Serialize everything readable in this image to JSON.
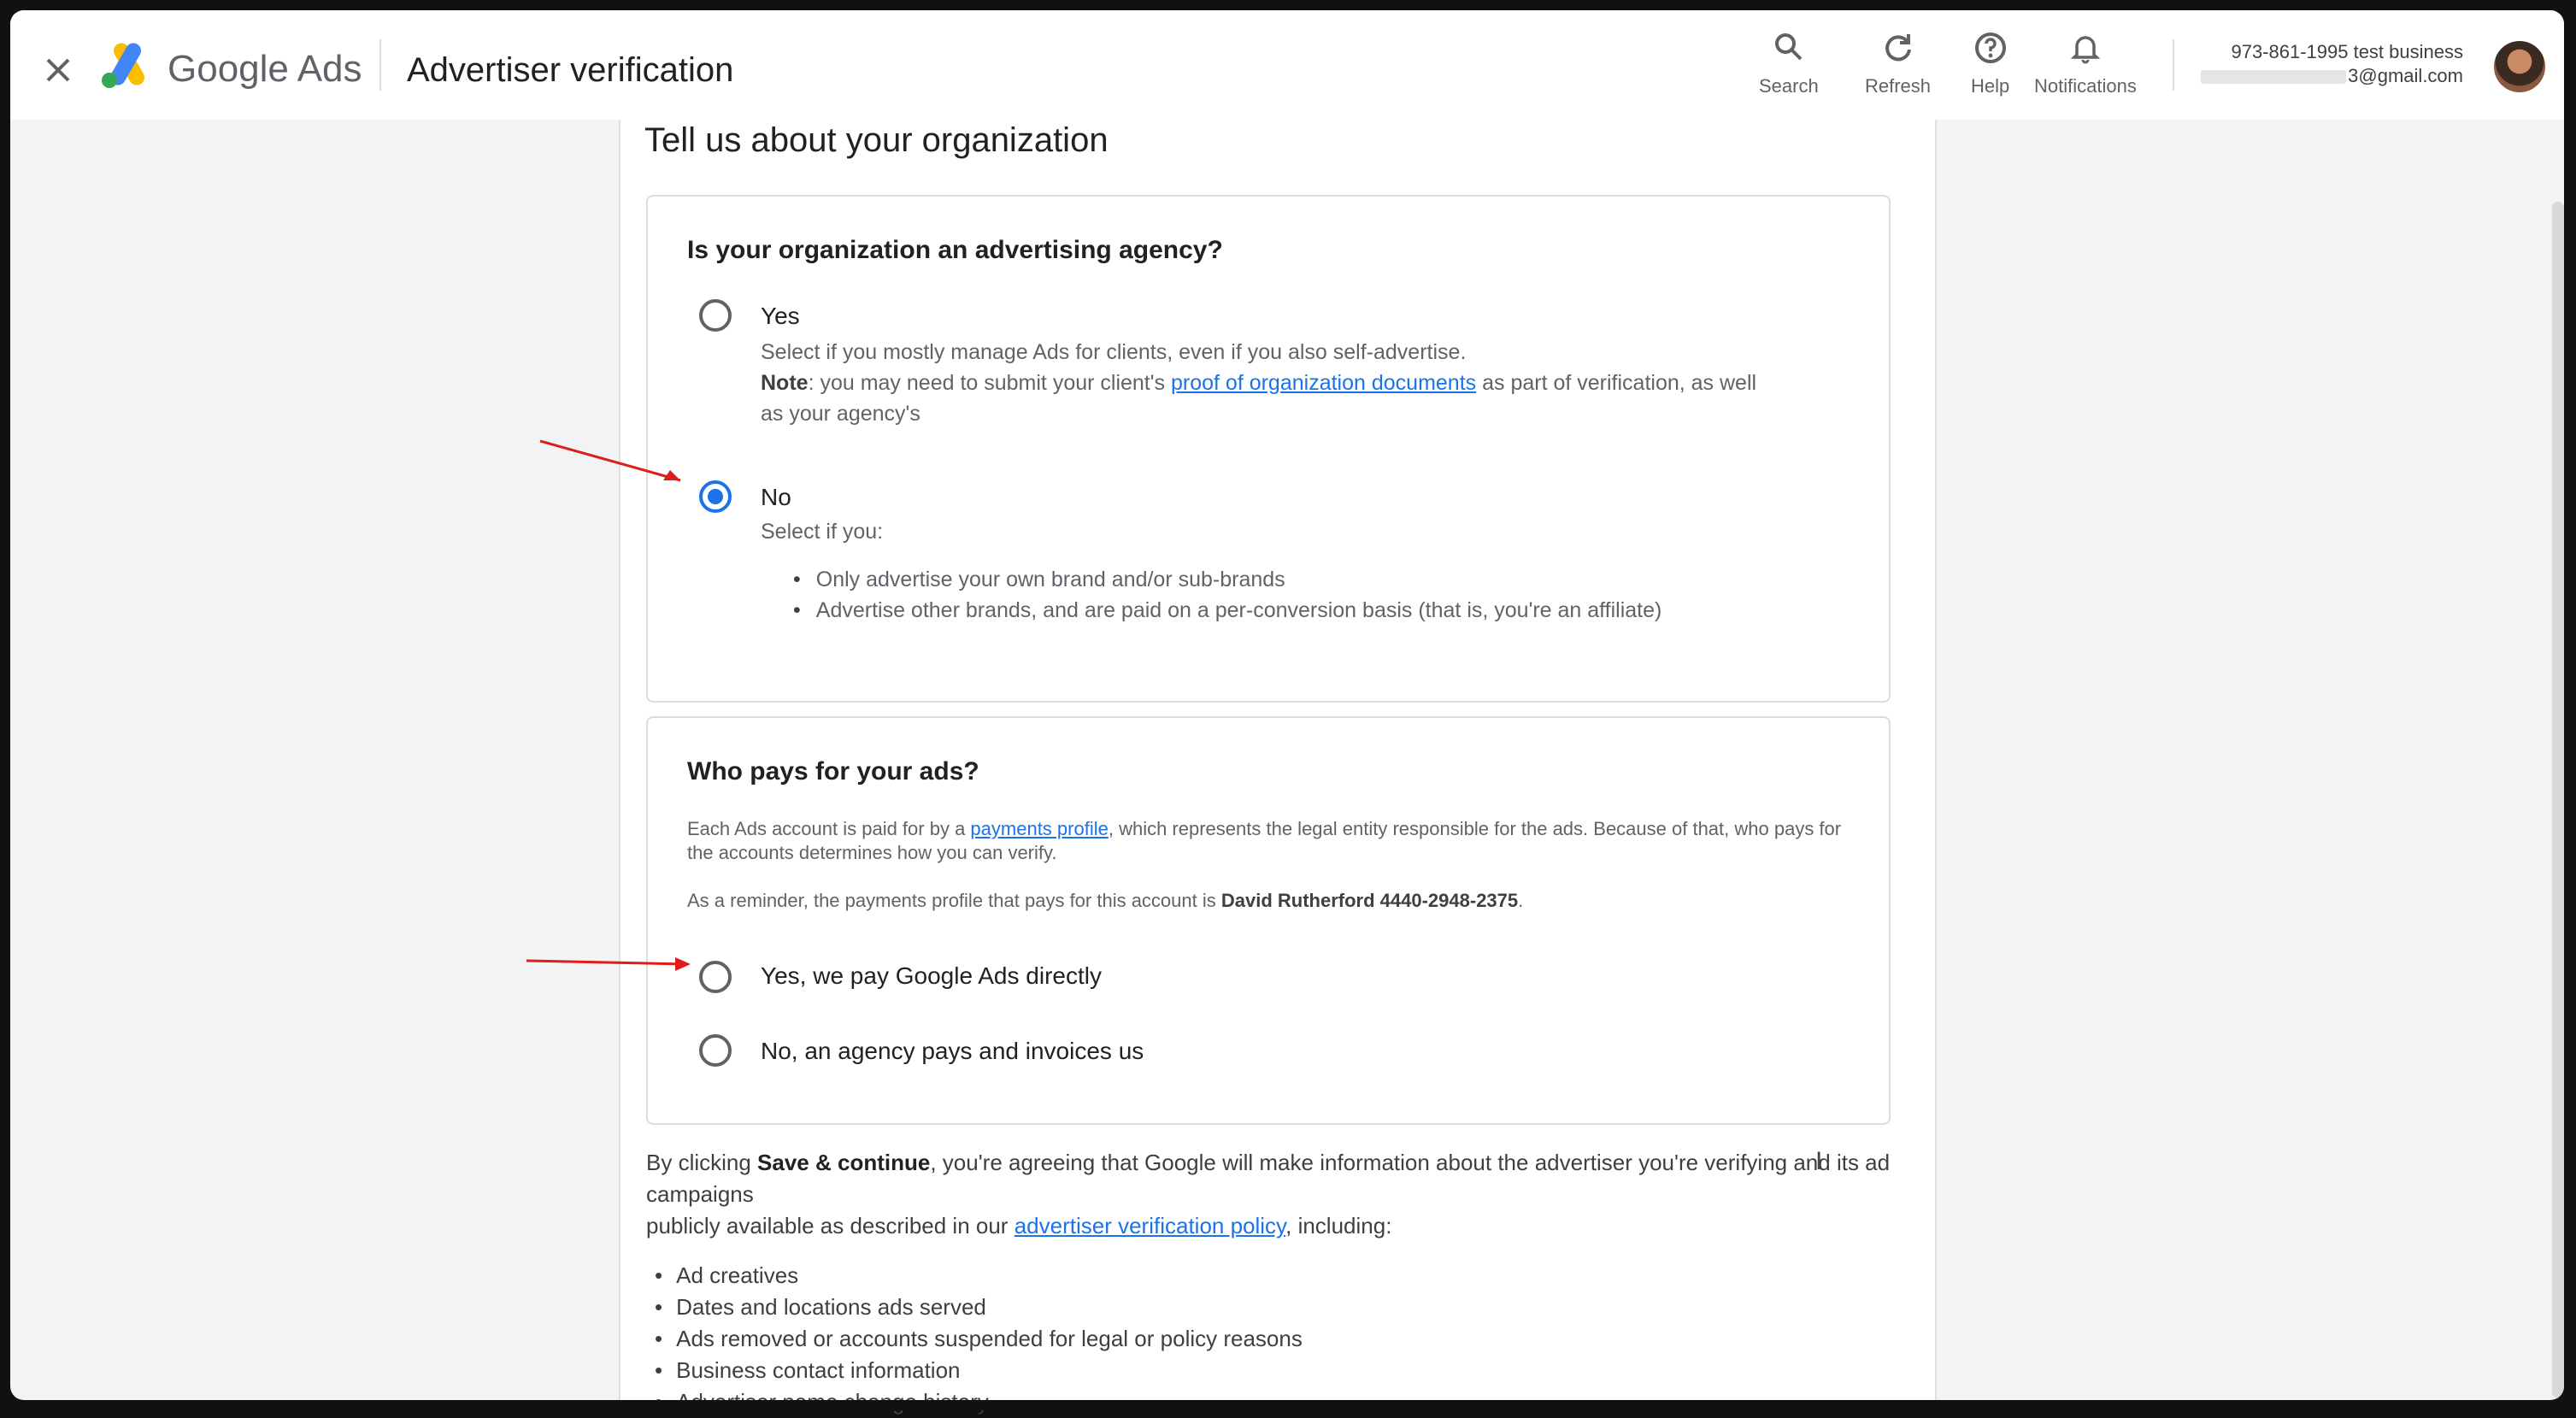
{
  "header": {
    "brand_google": "Google",
    "brand_ads": "Ads",
    "title": "Advertiser verification",
    "actions": {
      "search": "Search",
      "refresh": "Refresh",
      "help": "Help",
      "notifications": "Notifications"
    },
    "account_name": "973-861-1995 test business",
    "account_email_suffix": "3@gmail.com"
  },
  "section": {
    "title": "Tell us about your organization"
  },
  "agency_question": {
    "title": "Is your organization an advertising agency?",
    "yes_label": "Yes",
    "yes_desc_line1": "Select if you mostly manage Ads for clients, even if you also self-advertise.",
    "yes_note_bold": "Note",
    "yes_note_text": ": you may need to submit your client's ",
    "yes_note_link": "proof of organization documents",
    "yes_note_tail": " as part of verification, as well",
    "yes_note_line2": "as your agency's",
    "no_label": "No",
    "no_desc": "Select if you:",
    "no_bullets": [
      "Only advertise your own brand and/or sub-brands",
      "Advertise other brands, and are paid on a per-conversion basis (that is, you're an affiliate)"
    ],
    "selected": "No"
  },
  "pay_question": {
    "title": "Who pays for your ads?",
    "info1_pre": "Each Ads account is paid for by a ",
    "info1_link": "payments profile",
    "info1_post": ", which represents the legal entity responsible for the ads. Because of that, who pays for the accounts determines how you can verify.",
    "info2_pre": "As a reminder, the payments profile that pays for this account is ",
    "info2_bold": "David Rutherford 4440-2948-2375",
    "info2_post": ".",
    "option1": "Yes, we pay Google Ads directly",
    "option2": "No, an agency pays and invoices us"
  },
  "consent": {
    "pre": "By clicking ",
    "bold": "Save & continue",
    "mid": ", you're agreeing that Google will make information about the advertiser you're verifying and its ad campaigns",
    "line2_pre": "publicly available as described in our ",
    "link": "advertiser verification policy",
    "line2_post": ", including:",
    "items": [
      "Ad creatives",
      "Dates and locations ads served",
      "Ads removed or accounts suspended for legal or policy reasons",
      "Business contact information",
      "Advertiser name change history"
    ]
  },
  "colors": {
    "accent": "#1a73e8",
    "annotation_arrow": "#e01b1b"
  }
}
